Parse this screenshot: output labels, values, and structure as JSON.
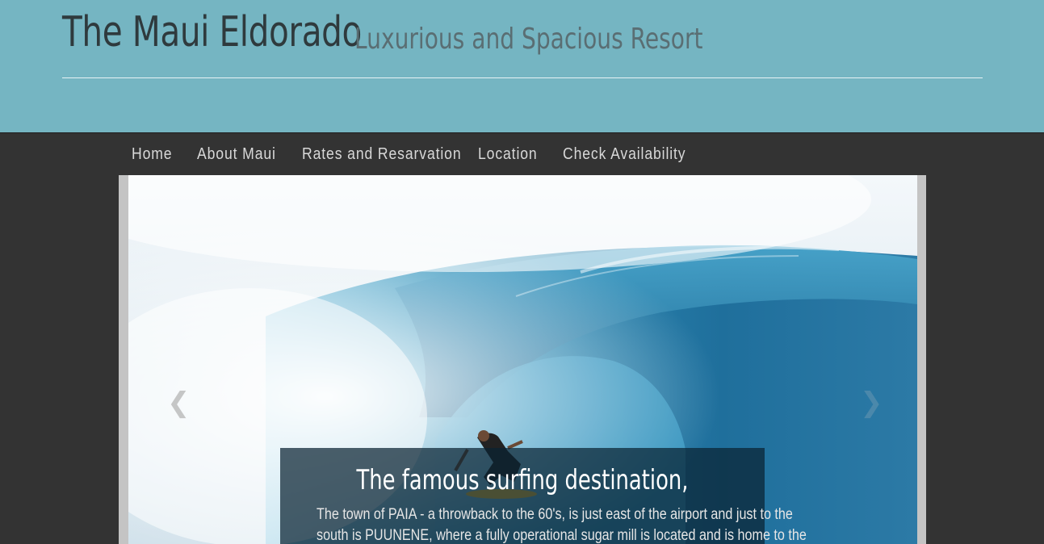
{
  "header": {
    "site_title": "The Maui Eldorado",
    "tagline": "Luxurious and Spacious Resort"
  },
  "nav": {
    "items": [
      {
        "label": "Home"
      },
      {
        "label": "About Maui"
      },
      {
        "label": "Rates and Resarvation"
      },
      {
        "label": "Location"
      },
      {
        "label": "Check Availability"
      }
    ]
  },
  "carousel": {
    "prev_icon": "chevron-left-icon",
    "next_icon": "chevron-right-icon",
    "caption": {
      "title": "The famous surfing destination,",
      "line1": "The town of PAIA - a throwback to the 60's, is just east of the airport and just to the",
      "line2": "south is PUUNENE, where a fully operational sugar mill is located and is home to the"
    }
  },
  "colors": {
    "header_bg": "#75b5c2",
    "page_bg": "#333333",
    "nav_text": "#d8d8d8",
    "title_text": "#2f3a3d"
  }
}
